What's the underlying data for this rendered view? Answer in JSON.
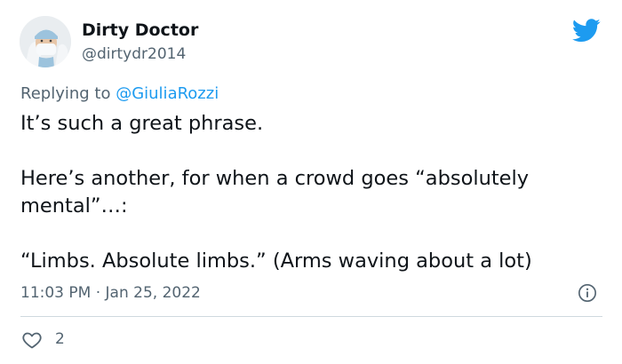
{
  "author": {
    "display_name": "Dirty Doctor",
    "handle": "@dirtydr2014",
    "avatar_icon": "surgeon-avatar"
  },
  "platform_icon": "twitter-bird-icon",
  "brand_color": "#1d9bf0",
  "reply": {
    "prefix": "Replying to ",
    "mention": "@GiuliaRozzi"
  },
  "tweet": {
    "paragraphs": [
      "It’s such a great phrase.",
      "Here’s another, for when a crowd goes “absolutely\nmental”…:",
      "“Limbs. Absolute limbs.” (Arms waving about a lot)"
    ],
    "timestamp": "11:03 PM · Jan 25, 2022"
  },
  "engagement": {
    "likes": "2"
  }
}
